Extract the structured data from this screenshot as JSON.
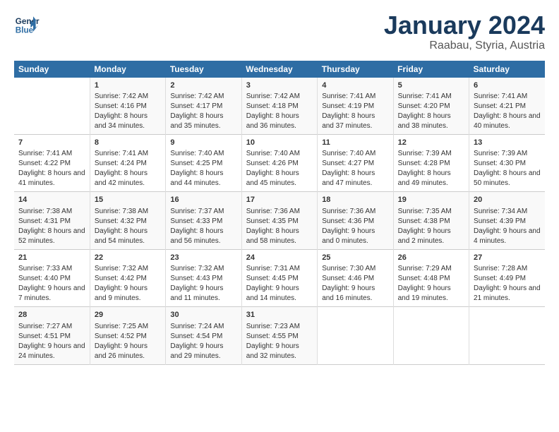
{
  "header": {
    "logo_line1": "General",
    "logo_line2": "Blue",
    "title": "January 2024",
    "subtitle": "Raabau, Styria, Austria"
  },
  "weekdays": [
    "Sunday",
    "Monday",
    "Tuesday",
    "Wednesday",
    "Thursday",
    "Friday",
    "Saturday"
  ],
  "weeks": [
    [
      {
        "day": "",
        "sunrise": "",
        "sunset": "",
        "daylight": ""
      },
      {
        "day": "1",
        "sunrise": "Sunrise: 7:42 AM",
        "sunset": "Sunset: 4:16 PM",
        "daylight": "Daylight: 8 hours and 34 minutes."
      },
      {
        "day": "2",
        "sunrise": "Sunrise: 7:42 AM",
        "sunset": "Sunset: 4:17 PM",
        "daylight": "Daylight: 8 hours and 35 minutes."
      },
      {
        "day": "3",
        "sunrise": "Sunrise: 7:42 AM",
        "sunset": "Sunset: 4:18 PM",
        "daylight": "Daylight: 8 hours and 36 minutes."
      },
      {
        "day": "4",
        "sunrise": "Sunrise: 7:41 AM",
        "sunset": "Sunset: 4:19 PM",
        "daylight": "Daylight: 8 hours and 37 minutes."
      },
      {
        "day": "5",
        "sunrise": "Sunrise: 7:41 AM",
        "sunset": "Sunset: 4:20 PM",
        "daylight": "Daylight: 8 hours and 38 minutes."
      },
      {
        "day": "6",
        "sunrise": "Sunrise: 7:41 AM",
        "sunset": "Sunset: 4:21 PM",
        "daylight": "Daylight: 8 hours and 40 minutes."
      }
    ],
    [
      {
        "day": "7",
        "sunrise": "Sunrise: 7:41 AM",
        "sunset": "Sunset: 4:22 PM",
        "daylight": "Daylight: 8 hours and 41 minutes."
      },
      {
        "day": "8",
        "sunrise": "Sunrise: 7:41 AM",
        "sunset": "Sunset: 4:24 PM",
        "daylight": "Daylight: 8 hours and 42 minutes."
      },
      {
        "day": "9",
        "sunrise": "Sunrise: 7:40 AM",
        "sunset": "Sunset: 4:25 PM",
        "daylight": "Daylight: 8 hours and 44 minutes."
      },
      {
        "day": "10",
        "sunrise": "Sunrise: 7:40 AM",
        "sunset": "Sunset: 4:26 PM",
        "daylight": "Daylight: 8 hours and 45 minutes."
      },
      {
        "day": "11",
        "sunrise": "Sunrise: 7:40 AM",
        "sunset": "Sunset: 4:27 PM",
        "daylight": "Daylight: 8 hours and 47 minutes."
      },
      {
        "day": "12",
        "sunrise": "Sunrise: 7:39 AM",
        "sunset": "Sunset: 4:28 PM",
        "daylight": "Daylight: 8 hours and 49 minutes."
      },
      {
        "day": "13",
        "sunrise": "Sunrise: 7:39 AM",
        "sunset": "Sunset: 4:30 PM",
        "daylight": "Daylight: 8 hours and 50 minutes."
      }
    ],
    [
      {
        "day": "14",
        "sunrise": "Sunrise: 7:38 AM",
        "sunset": "Sunset: 4:31 PM",
        "daylight": "Daylight: 8 hours and 52 minutes."
      },
      {
        "day": "15",
        "sunrise": "Sunrise: 7:38 AM",
        "sunset": "Sunset: 4:32 PM",
        "daylight": "Daylight: 8 hours and 54 minutes."
      },
      {
        "day": "16",
        "sunrise": "Sunrise: 7:37 AM",
        "sunset": "Sunset: 4:33 PM",
        "daylight": "Daylight: 8 hours and 56 minutes."
      },
      {
        "day": "17",
        "sunrise": "Sunrise: 7:36 AM",
        "sunset": "Sunset: 4:35 PM",
        "daylight": "Daylight: 8 hours and 58 minutes."
      },
      {
        "day": "18",
        "sunrise": "Sunrise: 7:36 AM",
        "sunset": "Sunset: 4:36 PM",
        "daylight": "Daylight: 9 hours and 0 minutes."
      },
      {
        "day": "19",
        "sunrise": "Sunrise: 7:35 AM",
        "sunset": "Sunset: 4:38 PM",
        "daylight": "Daylight: 9 hours and 2 minutes."
      },
      {
        "day": "20",
        "sunrise": "Sunrise: 7:34 AM",
        "sunset": "Sunset: 4:39 PM",
        "daylight": "Daylight: 9 hours and 4 minutes."
      }
    ],
    [
      {
        "day": "21",
        "sunrise": "Sunrise: 7:33 AM",
        "sunset": "Sunset: 4:40 PM",
        "daylight": "Daylight: 9 hours and 7 minutes."
      },
      {
        "day": "22",
        "sunrise": "Sunrise: 7:32 AM",
        "sunset": "Sunset: 4:42 PM",
        "daylight": "Daylight: 9 hours and 9 minutes."
      },
      {
        "day": "23",
        "sunrise": "Sunrise: 7:32 AM",
        "sunset": "Sunset: 4:43 PM",
        "daylight": "Daylight: 9 hours and 11 minutes."
      },
      {
        "day": "24",
        "sunrise": "Sunrise: 7:31 AM",
        "sunset": "Sunset: 4:45 PM",
        "daylight": "Daylight: 9 hours and 14 minutes."
      },
      {
        "day": "25",
        "sunrise": "Sunrise: 7:30 AM",
        "sunset": "Sunset: 4:46 PM",
        "daylight": "Daylight: 9 hours and 16 minutes."
      },
      {
        "day": "26",
        "sunrise": "Sunrise: 7:29 AM",
        "sunset": "Sunset: 4:48 PM",
        "daylight": "Daylight: 9 hours and 19 minutes."
      },
      {
        "day": "27",
        "sunrise": "Sunrise: 7:28 AM",
        "sunset": "Sunset: 4:49 PM",
        "daylight": "Daylight: 9 hours and 21 minutes."
      }
    ],
    [
      {
        "day": "28",
        "sunrise": "Sunrise: 7:27 AM",
        "sunset": "Sunset: 4:51 PM",
        "daylight": "Daylight: 9 hours and 24 minutes."
      },
      {
        "day": "29",
        "sunrise": "Sunrise: 7:25 AM",
        "sunset": "Sunset: 4:52 PM",
        "daylight": "Daylight: 9 hours and 26 minutes."
      },
      {
        "day": "30",
        "sunrise": "Sunrise: 7:24 AM",
        "sunset": "Sunset: 4:54 PM",
        "daylight": "Daylight: 9 hours and 29 minutes."
      },
      {
        "day": "31",
        "sunrise": "Sunrise: 7:23 AM",
        "sunset": "Sunset: 4:55 PM",
        "daylight": "Daylight: 9 hours and 32 minutes."
      },
      {
        "day": "",
        "sunrise": "",
        "sunset": "",
        "daylight": ""
      },
      {
        "day": "",
        "sunrise": "",
        "sunset": "",
        "daylight": ""
      },
      {
        "day": "",
        "sunrise": "",
        "sunset": "",
        "daylight": ""
      }
    ]
  ]
}
